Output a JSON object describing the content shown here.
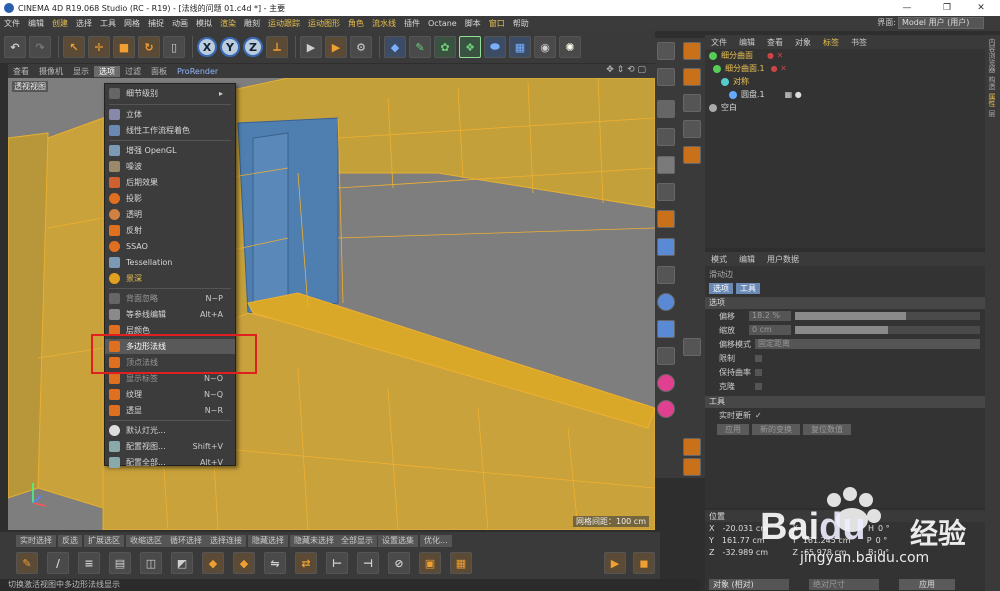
{
  "window": {
    "title": "CINEMA 4D R19.068 Studio (RC - R19) - [法线的问题 01.c4d *] - 主要",
    "min": "—",
    "max": "❐",
    "close": "✕"
  },
  "menubar": {
    "items": [
      "文件",
      "编辑",
      "创建",
      "选择",
      "工具",
      "网格",
      "捕捉",
      "动画",
      "模拟",
      "渲染",
      "雕刻",
      "运动跟踪",
      "运动图形",
      "角色",
      "流水线",
      "插件",
      "Octane",
      "脚本",
      "窗口",
      "帮助"
    ],
    "layout_label": "界面:",
    "layout_value": "Model 用户 (用户)"
  },
  "viewport": {
    "tabs": [
      "查看",
      "摄像机",
      "显示",
      "选项",
      "过滤",
      "面板",
      "ProRender"
    ],
    "active_tab": "选项",
    "label": "透视视图",
    "grid_label": "网格间距：100 cm"
  },
  "context_menu": {
    "items": [
      {
        "label": "细节级别",
        "shortcut": "▸",
        "style": "normal"
      },
      {
        "label": "立体",
        "shortcut": "",
        "style": "normal"
      },
      {
        "label": "线性工作流程着色",
        "shortcut": "",
        "style": "normal"
      },
      {
        "label": "增强 OpenGL",
        "shortcut": "",
        "style": "normal"
      },
      {
        "label": "噪波",
        "shortcut": "",
        "style": "normal"
      },
      {
        "label": "后期效果",
        "shortcut": "",
        "style": "normal"
      },
      {
        "label": "投影",
        "shortcut": "",
        "style": "normal"
      },
      {
        "label": "透明",
        "shortcut": "",
        "style": "normal"
      },
      {
        "label": "反射",
        "shortcut": "",
        "style": "normal"
      },
      {
        "label": "SSAO",
        "shortcut": "",
        "style": "normal"
      },
      {
        "label": "Tessellation",
        "shortcut": "",
        "style": "normal"
      },
      {
        "label": "景深",
        "shortcut": "",
        "style": "yellow"
      },
      {
        "label": "背面忽略",
        "shortcut": "N~P",
        "style": "dim"
      },
      {
        "label": "等参线编辑",
        "shortcut": "Alt+A",
        "style": "normal"
      },
      {
        "label": "层颜色",
        "shortcut": "",
        "style": "normal"
      },
      {
        "label": "多边形法线",
        "shortcut": "",
        "style": "highlight"
      },
      {
        "label": "顶点法线",
        "shortcut": "",
        "style": "dim"
      },
      {
        "label": "显示标签",
        "shortcut": "N~O",
        "style": "dim"
      },
      {
        "label": "纹理",
        "shortcut": "N~Q",
        "style": "normal"
      },
      {
        "label": "透显",
        "shortcut": "N~R",
        "style": "normal"
      },
      {
        "label": "默认灯光...",
        "shortcut": "",
        "style": "normal"
      },
      {
        "label": "配置视图...",
        "shortcut": "Shift+V",
        "style": "normal"
      },
      {
        "label": "配置全部...",
        "shortcut": "Alt+V",
        "style": "normal"
      }
    ]
  },
  "object_manager": {
    "menu": [
      "文件",
      "编辑",
      "查看",
      "对象",
      "标签",
      "书签"
    ],
    "objects": [
      {
        "name": "细分曲面",
        "color": "yellow"
      },
      {
        "name": "细分曲面.1",
        "color": "yellow"
      },
      {
        "name": "对称",
        "color": "yellow"
      },
      {
        "name": "圆盘.1",
        "color": "white"
      },
      {
        "name": "空白",
        "color": "white"
      }
    ]
  },
  "attributes": {
    "menu": [
      "模式",
      "编辑",
      "用户数据"
    ],
    "title": "滑动边",
    "tabs": [
      "选项",
      "工具"
    ],
    "section_options": "选项",
    "offset_label": "偏移",
    "offset_value": "18.2 %",
    "offset_fraction": 0.6,
    "scale_label": "缩放",
    "scale_value": "0 cm",
    "scale_fraction": 0.5,
    "offset_mode_label": "偏移模式",
    "offset_mode_value": "固定距离",
    "limit_label": "限制",
    "preserve_label": "保持曲率",
    "clone_label": "克隆",
    "section_tool": "工具",
    "realtime_label": "实时更新",
    "realtime_check": "✓",
    "buttons": [
      "应用",
      "新的变换",
      "复位数值"
    ]
  },
  "coordinates": {
    "header": "位置",
    "rows": [
      {
        "axis": "X",
        "value": "-20.031 cm",
        "axis2": "X",
        "value2": "",
        "axis3": "H",
        "value3": "0 °"
      },
      {
        "axis": "Y",
        "value": "161.77 cm",
        "axis2": "Y",
        "value2": "161.245 cm",
        "axis3": "P",
        "value3": "0 °"
      },
      {
        "axis": "Z",
        "value": "-32.989 cm",
        "axis2": "Z",
        "value2": "65.978 cm",
        "axis3": "B",
        "value3": "0 °"
      }
    ],
    "mode": "对象 (相对)",
    "size_mode": "绝对尺寸",
    "apply": "应用"
  },
  "bottom_tools": [
    "实时选择",
    "反选",
    "扩展选区",
    "收缩选区",
    "循环选择",
    "选择连接",
    "隐藏选择",
    "隐藏未选择",
    "全部显示",
    "设置选集",
    "优化..."
  ],
  "status": "切换激活视图中多边形法线显示",
  "right_strip": [
    "内容浏览器",
    "构造",
    "属性",
    "层"
  ],
  "watermark": {
    "brand": "Bai",
    "brand2": "du",
    "suffix": "经验",
    "url": "jingyan.baidu.com"
  },
  "colors": {
    "accent_yellow": "#e8c050",
    "highlight_red": "#e02020",
    "mesh_yellow": "#c9a23c",
    "mesh_blue": "#4f7fb0"
  }
}
